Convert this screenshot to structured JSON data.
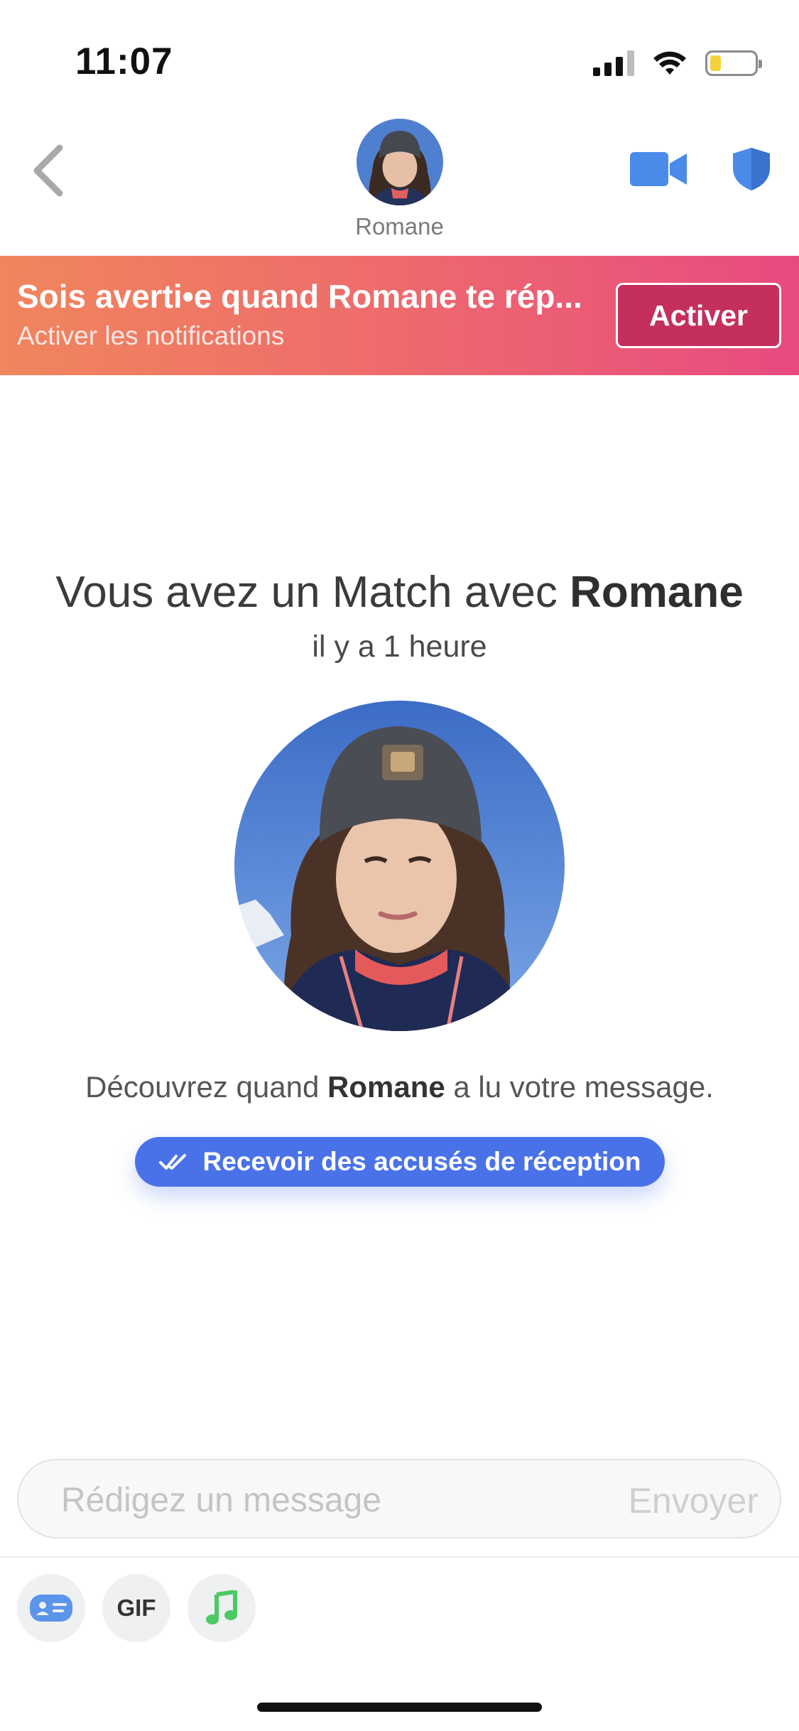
{
  "status_bar": {
    "time": "11:07",
    "battery_level": 0.25
  },
  "header": {
    "contact_name": "Romane"
  },
  "banner": {
    "title": "Sois averti•e quand Romane te rép...",
    "subtitle": "Activer les notifications",
    "button_label": "Activer"
  },
  "match": {
    "title_prefix": "Vous avez un Match avec ",
    "title_name": "Romane",
    "time": "il y a 1 heure"
  },
  "read_receipts": {
    "text_prefix": "Découvrez quand ",
    "text_name": "Romane",
    "text_suffix": " a lu votre message.",
    "button_label": "Recevoir des accusés de réception"
  },
  "composer": {
    "placeholder": "Rédigez un message",
    "value": "",
    "send_label": "Envoyer"
  },
  "tools": {
    "gif_label": "GIF"
  },
  "colors": {
    "accent_blue": "#4a72e8",
    "banner_start": "#f0865d",
    "banner_end": "#e84a80",
    "music_green": "#4cc964"
  }
}
